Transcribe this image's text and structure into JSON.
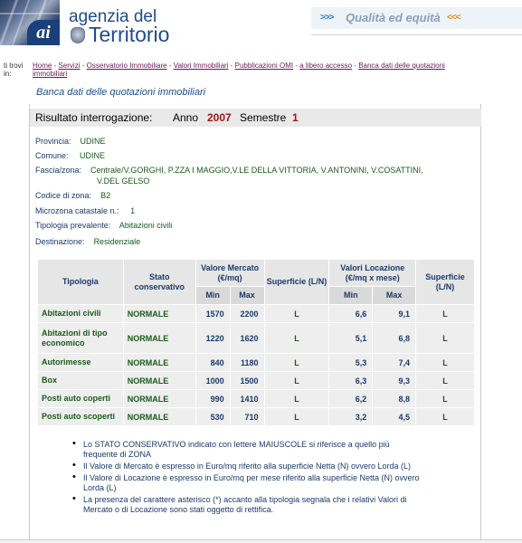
{
  "header": {
    "logo_letters": "ai",
    "brand_top": "agenzia del",
    "brand_bottom": "Territorio",
    "slogan_left_arrows": ">>>",
    "slogan": "Qualità ed equità",
    "slogan_right_arrows": "<<<",
    "emblem_icon": "italian-republic-emblem-icon"
  },
  "breadcrumb": {
    "prefix": "ti trovi in:",
    "items": [
      "Home",
      "Servizi",
      "Osservatorio Immobiliare",
      "Valori Immobiliari",
      "Pubblicazioni OMI",
      "a libero accesso",
      "Banca dati delle quotazioni immobiliari"
    ],
    "separator": "-"
  },
  "page_title": "Banca dati delle quotazioni immobiliari",
  "result": {
    "label": "Risultato interrogazione:",
    "anno_label": "Anno",
    "anno_value": "2007",
    "semestre_label": "Semestre",
    "semestre_value": "1"
  },
  "fields": {
    "provincia_label": "Provincia:",
    "provincia_value": "UDINE",
    "comune_label": "Comune:",
    "comune_value": "UDINE",
    "fascia_label": "Fascia/zona:",
    "fascia_value_1": "Centrale/V.GORGHI, P.ZZA I MAGGIO,V.LE DELLA VITTORIA, V.ANTONINI, V.COSATTINI,",
    "fascia_value_2": "V.DEL GELSO",
    "codice_label": "Codice di zona:",
    "codice_value": "B2",
    "microzona_label": "Microzona catastale n.:",
    "microzona_value": "1",
    "tipologia_label": "Tipologia prevalente:",
    "tipologia_value": "Abitazioni civili",
    "destinazione_label": "Destinazione:",
    "destinazione_value": "Residenziale"
  },
  "table": {
    "headers": {
      "tipologia": "Tipologia",
      "stato": "Stato conservativo",
      "valore_mercato": "Valore Mercato (€/mq)",
      "superficie_1": "Superficie (L/N)",
      "valori_locazione": "Valori Locazione (€/mq x mese)",
      "superficie_2": "Superficie (L/N)",
      "min": "Min",
      "max": "Max"
    },
    "rows": [
      {
        "tipologia": "Abitazioni civili",
        "stato": "NORMALE",
        "vm_min": "1570",
        "vm_max": "2200",
        "sup1": "L",
        "vl_min": "6,6",
        "vl_max": "9,1",
        "sup2": "L"
      },
      {
        "tipologia": "Abitazioni di tipo economico",
        "stato": "NORMALE",
        "vm_min": "1220",
        "vm_max": "1620",
        "sup1": "L",
        "vl_min": "5,1",
        "vl_max": "6,8",
        "sup2": "L"
      },
      {
        "tipologia": "Autorimesse",
        "stato": "NORMALE",
        "vm_min": "840",
        "vm_max": "1180",
        "sup1": "L",
        "vl_min": "5,3",
        "vl_max": "7,4",
        "sup2": "L"
      },
      {
        "tipologia": "Box",
        "stato": "NORMALE",
        "vm_min": "1000",
        "vm_max": "1500",
        "sup1": "L",
        "vl_min": "6,3",
        "vl_max": "9,3",
        "sup2": "L"
      },
      {
        "tipologia": "Posti auto coperti",
        "stato": "NORMALE",
        "vm_min": "990",
        "vm_max": "1410",
        "sup1": "L",
        "vl_min": "6,2",
        "vl_max": "8,8",
        "sup2": "L"
      },
      {
        "tipologia": "Posti auto scoperti",
        "stato": "NORMALE",
        "vm_min": "530",
        "vm_max": "710",
        "sup1": "L",
        "vl_min": "3,2",
        "vl_max": "4,5",
        "sup2": "L"
      }
    ]
  },
  "notes": [
    "Lo STATO CONSERVATIVO indicato con lettere MAIUSCOLE si riferisce a quello più frequente di ZONA",
    "Il Valore di Mercato è espresso in Euro/mq riferito alla superficie Netta (N) ovvero Lorda (L)",
    "Il Valore di Locazione è espresso in Euro/mq per mese riferito alla superficie Netta (N) ovvero Lorda (L)",
    "La presenza del carattere asterisco (*) accanto alla tipologia segnala che i relativi Valori di Mercato o di Locazione sono stati oggetto di rettifica."
  ]
}
